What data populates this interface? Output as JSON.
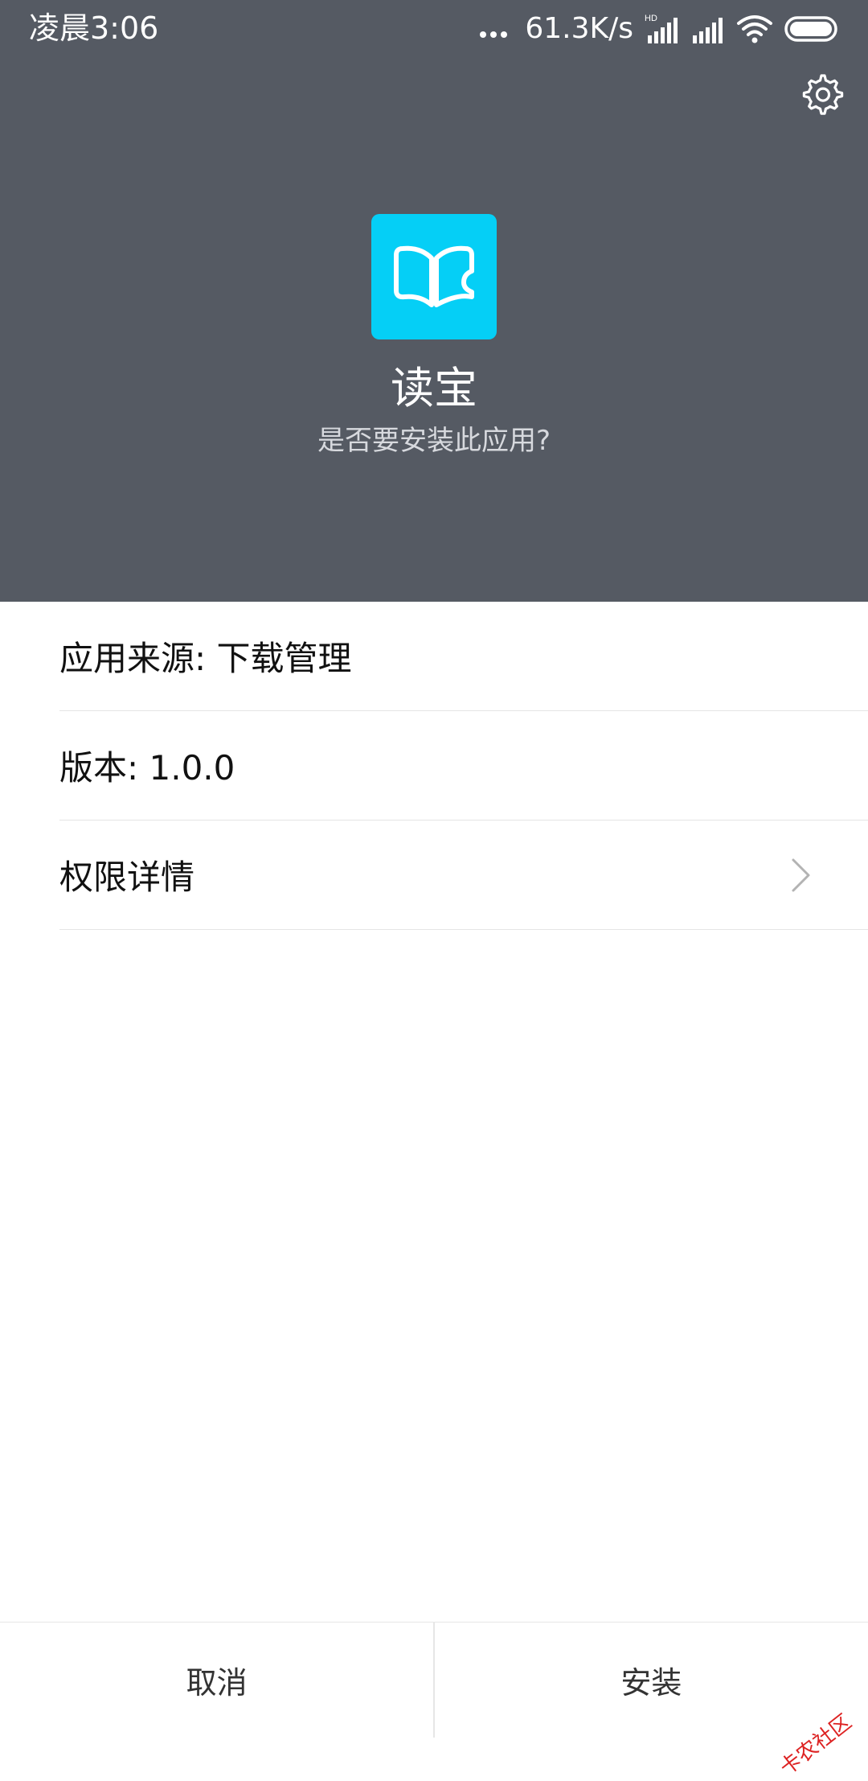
{
  "status_bar": {
    "time": "凌晨3:06",
    "net_speed": "61.3K/s",
    "hd_label": "HD"
  },
  "app": {
    "name": "读宝",
    "question": "是否要安装此应用?",
    "icon": "open-book-icon",
    "icon_color": "#05cff6"
  },
  "info": {
    "items": [
      {
        "label": "应用来源: 下载管理"
      },
      {
        "label": "版本: 1.0.0"
      },
      {
        "label": "权限详情"
      }
    ]
  },
  "actions": {
    "cancel_label": "取消",
    "install_label": "安装"
  },
  "watermark": {
    "text": "卡农社区"
  },
  "colors": {
    "header_bg": "#555a63",
    "accent": "#05cff6"
  }
}
